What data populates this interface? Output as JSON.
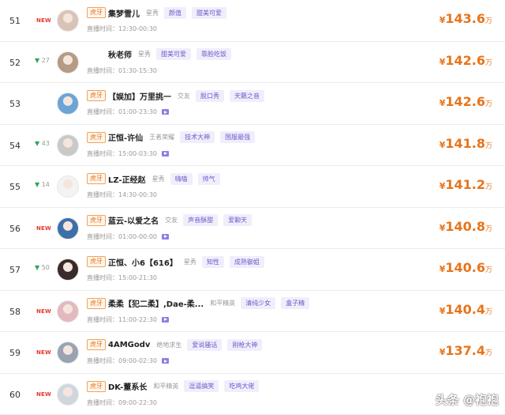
{
  "colors": {
    "accent": "#e8741a",
    "tag_text": "#6a5bc8",
    "tag_bg": "#f1eefc",
    "new_badge": "#e5372b",
    "rank_up": "#2aa55a"
  },
  "time_label": "直播时间：",
  "currency": "¥",
  "unit": "万",
  "watermark": "头条 @袍袍",
  "rows": [
    {
      "rank": "51",
      "badge": "NEW",
      "change": "",
      "platform": "虎牙",
      "name": "集梦雪儿",
      "category": "星秀",
      "tags": [
        "颜值",
        "甜美可爱"
      ],
      "time": "12:30-00:30",
      "video": false,
      "value": "143.6",
      "avatar_color": "#d9c3b7"
    },
    {
      "rank": "52",
      "badge": "",
      "change": "27",
      "platform": "",
      "name": "秋老师",
      "category": "星秀",
      "tags": [
        "甜美可爱",
        "靠脸吃饭"
      ],
      "time": "01:30-15:30",
      "video": false,
      "value": "142.6",
      "avatar_color": "#b59a84"
    },
    {
      "rank": "53",
      "badge": "",
      "change": "",
      "platform": "虎牙",
      "name": "【娱加】万里挑一",
      "category": "交友",
      "tags": [
        "脱口秀",
        "天籁之音"
      ],
      "time": "01:00-23:30",
      "video": true,
      "value": "142.6",
      "avatar_color": "#6aa5d6"
    },
    {
      "rank": "54",
      "badge": "",
      "change": "43",
      "platform": "虎牙",
      "name": "正恒-许仙",
      "category": "王者荣耀",
      "tags": [
        "技术大神",
        "国服最强"
      ],
      "time": "15:00-03:30",
      "video": true,
      "value": "141.8",
      "avatar_color": "#c9c9c9"
    },
    {
      "rank": "55",
      "badge": "",
      "change": "14",
      "platform": "虎牙",
      "name": "LZ-正经赵",
      "category": "星秀",
      "tags": [
        "嗨嗑",
        "帅气"
      ],
      "time": "14:30-00:30",
      "video": false,
      "value": "141.2",
      "avatar_color": "#f3f3f3"
    },
    {
      "rank": "56",
      "badge": "NEW",
      "change": "",
      "platform": "虎牙",
      "name": "蓝云-以爱之名",
      "category": "交友",
      "tags": [
        "声音酥甜",
        "爱聊天"
      ],
      "time": "01:00-00:00",
      "video": true,
      "value": "140.8",
      "avatar_color": "#3d6fa8"
    },
    {
      "rank": "57",
      "badge": "",
      "change": "50",
      "platform": "虎牙",
      "name": "正恒、小6【616】",
      "category": "星秀",
      "tags": [
        "知性",
        "成熟御姐"
      ],
      "time": "15:00-21:30",
      "video": false,
      "value": "140.6",
      "avatar_color": "#3a2b2a"
    },
    {
      "rank": "58",
      "badge": "NEW",
      "change": "",
      "platform": "虎牙",
      "name": "柔柔【犯二柔】,Dae-柔...",
      "category": "和平精英",
      "tags": [
        "清纯少女",
        "盒子精"
      ],
      "time": "11:00-22:30",
      "video": true,
      "value": "140.4",
      "avatar_color": "#e3b9c0"
    },
    {
      "rank": "59",
      "badge": "NEW",
      "change": "",
      "platform": "虎牙",
      "name": "4AMGodv",
      "category": "绝地求生",
      "tags": [
        "爱说骚话",
        "刚枪大神"
      ],
      "time": "09:00-02:30",
      "video": true,
      "value": "137.4",
      "avatar_color": "#9aa3b2"
    },
    {
      "rank": "60",
      "badge": "NEW",
      "change": "",
      "platform": "虎牙",
      "name": "DK-董系长",
      "category": "和平精英",
      "tags": [
        "逗逼搞笑",
        "吃鸡大佬"
      ],
      "time": "09:00-22:30",
      "video": false,
      "value": "",
      "avatar_color": "#d0d6de"
    }
  ]
}
